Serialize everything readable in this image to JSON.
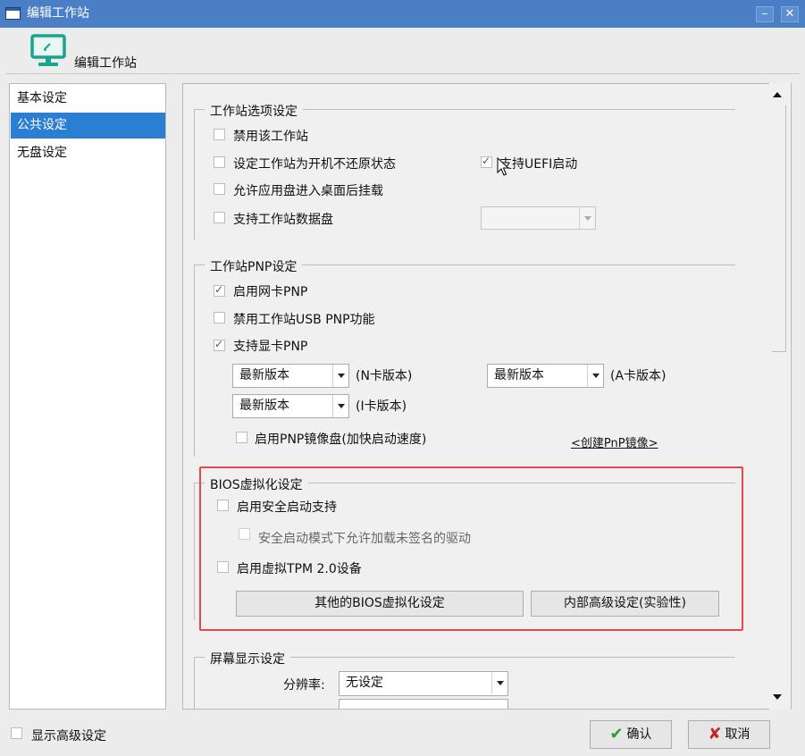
{
  "window": {
    "title": "编辑工作站",
    "min_label": "–",
    "close_label": "✕"
  },
  "header": {
    "title": "编辑工作站",
    "icon": "monitor-icon"
  },
  "nav": {
    "items": [
      {
        "label": "基本设定"
      },
      {
        "label": "公共设定",
        "selected": true
      },
      {
        "label": "无盘设定"
      }
    ]
  },
  "workstation_options": {
    "title": "工作站选项设定",
    "disable_workstation": {
      "label": "禁用该工作站",
      "checked": false
    },
    "no_restore_on_boot": {
      "label": "设定工作站为开机不还原状态",
      "checked": false
    },
    "support_uefi": {
      "label": "支持UEFI启动",
      "checked": true
    },
    "mount_app_disk": {
      "label": "允许应用盘进入桌面后挂载",
      "checked": false
    },
    "support_data_disk": {
      "label": "支持工作站数据盘",
      "checked": false
    },
    "data_disk_select": {
      "value": ""
    }
  },
  "pnp": {
    "title": "工作站PNP设定",
    "enable_nic_pnp": {
      "label": "启用网卡PNP",
      "checked": true
    },
    "disable_usb_pnp": {
      "label": "禁用工作站USB PNP功能",
      "checked": false
    },
    "support_gpu_pnp": {
      "label": "支持显卡PNP",
      "checked": true
    },
    "n_card": {
      "value": "最新版本",
      "label": "(N卡版本)"
    },
    "a_card": {
      "value": "最新版本",
      "label": "(A卡版本)"
    },
    "i_card": {
      "value": "最新版本",
      "label": "(I卡版本)"
    },
    "enable_pnp_mirror": {
      "label": "启用PNP镜像盘(加快启动速度)",
      "checked": false
    },
    "create_mirror_link": "<创建PnP镜像>"
  },
  "bios": {
    "title": "BIOS虚拟化设定",
    "secure_boot": {
      "label": "启用安全启动支持",
      "checked": false
    },
    "allow_unsigned": {
      "label": "安全启动模式下允许加载未签名的驱动",
      "checked": false
    },
    "virtual_tpm": {
      "label": "启用虚拟TPM 2.0设备",
      "checked": false
    },
    "other_bios_button": "其他的BIOS虚拟化设定",
    "advanced_button": "内部高级设定(实验性)"
  },
  "display": {
    "title": "屏幕显示设定",
    "resolution_label": "分辨率:",
    "resolution_value": "无设定"
  },
  "footer": {
    "show_advanced": {
      "label": "显示高级设定",
      "checked": false
    },
    "ok_label": "确认",
    "cancel_label": "取消"
  },
  "colors": {
    "titlebar": "#4a7fc6",
    "nav_selected": "#2b7fd3",
    "highlight_box": "#e8474b",
    "ok_check": "#2e9b2e",
    "cancel_x": "#c62828"
  }
}
